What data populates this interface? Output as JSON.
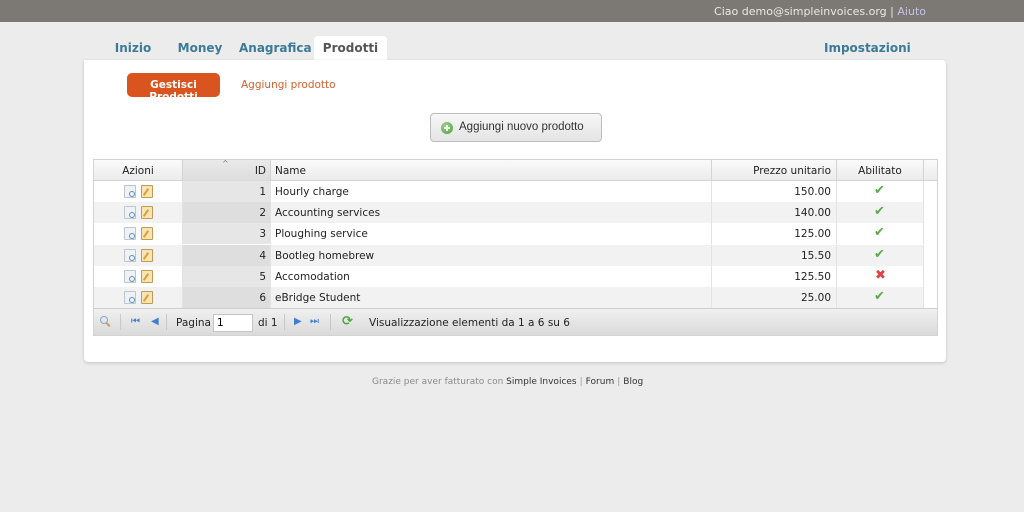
{
  "topbar": {
    "greeting": "Ciao demo@simpleinvoices.org",
    "separator": "|",
    "help": "Aiuto"
  },
  "tabs": [
    {
      "label": "Inizio",
      "active": false
    },
    {
      "label": "Money",
      "active": false
    },
    {
      "label": "Anagrafica",
      "active": false
    },
    {
      "label": "Prodotti",
      "active": true
    }
  ],
  "settings_label": "Impostazioni",
  "subnav": {
    "active": "Gestisci Prodotti",
    "link": "Aggiungi prodotto"
  },
  "add_button": {
    "label": "Aggiungi nuovo prodotto",
    "icon": "add-circle-icon"
  },
  "grid": {
    "columns": [
      "Azioni",
      "ID",
      "Name",
      "Prezzo unitario",
      "Abilitato"
    ],
    "sorted_column": "ID",
    "rows": [
      {
        "id": "1",
        "name": "Hourly charge",
        "price": "150.00",
        "enabled": true
      },
      {
        "id": "2",
        "name": "Accounting services",
        "price": "140.00",
        "enabled": true
      },
      {
        "id": "3",
        "name": "Ploughing service",
        "price": "125.00",
        "enabled": true
      },
      {
        "id": "4",
        "name": "Bootleg homebrew",
        "price": "15.50",
        "enabled": true
      },
      {
        "id": "5",
        "name": "Accomodation",
        "price": "125.50",
        "enabled": false
      },
      {
        "id": "6",
        "name": "eBridge Student",
        "price": "25.00",
        "enabled": true
      }
    ],
    "enabled_glyph": "✔",
    "disabled_glyph": "✖"
  },
  "pager": {
    "page_label": "Pagina",
    "page_value": "1",
    "of_label": "di 1",
    "status": "Visualizzazione elementi da 1 a 6 su 6",
    "first": "⏮",
    "prev": "◀",
    "next": "▶",
    "last": "⏭",
    "refresh": "⟳"
  },
  "footer": {
    "text": "Grazie per aver fatturato con",
    "brand": "Simple Invoices",
    "forum": "Forum",
    "blog": "Blog",
    "separator": "|"
  },
  "colors": {
    "accent": "#d9541e",
    "tab_link": "#3c7a98",
    "topbar": "#7c7874",
    "enabled": "#5aaa48",
    "disabled": "#e04040"
  }
}
